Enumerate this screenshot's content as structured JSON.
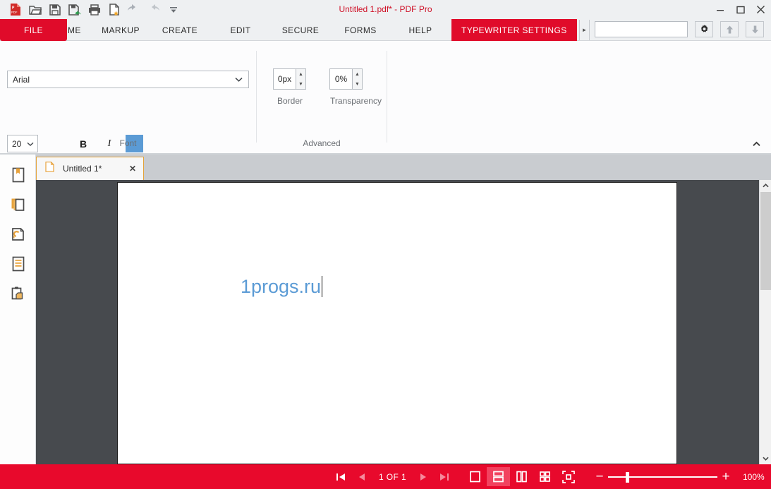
{
  "window": {
    "title": "Untitled 1.pdf* - PDF Pro",
    "minimize_label": "Minimize",
    "maximize_label": "Maximize",
    "close_label": "Close",
    "accent_color": "#e00b2a",
    "status_color": "#e8092c",
    "title_color": "#cf1228"
  },
  "quick_access": [
    {
      "name": "pdf-logo-icon",
      "tooltip": "PDF Pro"
    },
    {
      "name": "open-icon",
      "tooltip": "Open"
    },
    {
      "name": "save-icon",
      "tooltip": "Save"
    },
    {
      "name": "save-as-icon",
      "tooltip": "Save As"
    },
    {
      "name": "print-icon",
      "tooltip": "Print"
    },
    {
      "name": "new-document-icon",
      "tooltip": "New Document"
    },
    {
      "name": "undo-icon",
      "tooltip": "Undo"
    },
    {
      "name": "redo-icon",
      "tooltip": "Redo"
    },
    {
      "name": "customize-icon",
      "tooltip": "Customize Quick Access Toolbar"
    }
  ],
  "tabs": [
    {
      "label": "FILE",
      "active": true,
      "style": "file"
    },
    {
      "label": "HOME",
      "active": false,
      "style": "normal"
    },
    {
      "label": "MARKUP",
      "active": false,
      "style": "normal"
    },
    {
      "label": "CREATE",
      "active": false,
      "style": "normal"
    },
    {
      "label": "EDIT",
      "active": false,
      "style": "normal"
    },
    {
      "label": "SECURE",
      "active": false,
      "style": "normal"
    },
    {
      "label": "FORMS",
      "active": false,
      "style": "normal"
    },
    {
      "label": "HELP",
      "active": false,
      "style": "normal"
    },
    {
      "label": "TYPEWRITER SETTINGS",
      "active": true,
      "style": "accent"
    }
  ],
  "tab_nav": {
    "prev": "◄",
    "next": "►"
  },
  "search": {
    "value": "",
    "placeholder": ""
  },
  "header_buttons": [
    {
      "name": "settings-button",
      "label": "Settings"
    },
    {
      "name": "scroll-up-button",
      "label": "Up"
    },
    {
      "name": "scroll-down-button",
      "label": "Down"
    }
  ],
  "ribbon": {
    "collapse_label": "^",
    "groups": [
      {
        "name": "font",
        "label": "Font",
        "font_family": "Arial",
        "font_size": "20",
        "bold_label": "B",
        "italic_label": "I",
        "color_swatch": "#5b9bd5",
        "color_label": "Font Color"
      },
      {
        "name": "advanced",
        "label": "Advanced",
        "border": {
          "caption": "Border",
          "value": "0px"
        },
        "transparency": {
          "caption": "Transparency",
          "value": "0%"
        }
      }
    ]
  },
  "sidebar": {
    "items": [
      {
        "name": "sidebar-item-bookmarks",
        "label": "Bookmarks"
      },
      {
        "name": "sidebar-item-pages",
        "label": "Page Thumbnails"
      },
      {
        "name": "sidebar-item-attachments",
        "label": "Attachments"
      },
      {
        "name": "sidebar-item-content",
        "label": "Content"
      },
      {
        "name": "sidebar-item-clipboard",
        "label": "Clipboard"
      }
    ]
  },
  "document_tabs": [
    {
      "label": "Untitled 1*",
      "active": true,
      "close_label": "✕"
    }
  ],
  "document": {
    "text": "1progs.ru",
    "text_color": "#5b9bd5",
    "canvas_color": "#474a4e",
    "page_background": "#ffffff"
  },
  "statusbar": {
    "first_page_label": "First Page",
    "prev_page_label": "Previous Page",
    "page_indicator": "1 OF 1",
    "next_page_label": "Next Page",
    "last_page_label": "Last Page",
    "view_modes": [
      {
        "name": "view-mode-single-page",
        "label": "Single Page",
        "active": false
      },
      {
        "name": "view-mode-continuous",
        "label": "Continuous",
        "active": true
      },
      {
        "name": "view-mode-two-page",
        "label": "Two Page",
        "active": false
      },
      {
        "name": "view-mode-grid",
        "label": "Grid",
        "active": false
      },
      {
        "name": "view-mode-fit",
        "label": "Fit Page",
        "active": false
      }
    ],
    "zoom_out_label": "−",
    "zoom_in_label": "+",
    "zoom_level": "100%"
  }
}
